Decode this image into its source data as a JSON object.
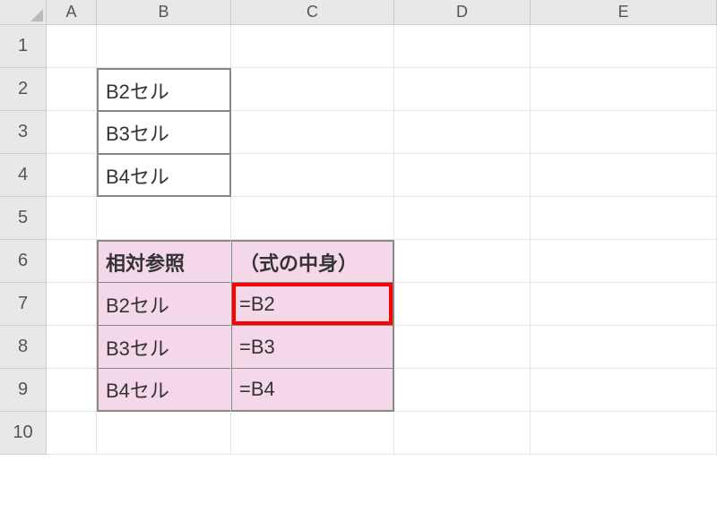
{
  "columns": [
    "A",
    "B",
    "C",
    "D",
    "E"
  ],
  "rows": [
    "1",
    "2",
    "3",
    "4",
    "5",
    "6",
    "7",
    "8",
    "9",
    "10"
  ],
  "cells": {
    "B2": "B2セル",
    "B3": "B3セル",
    "B4": "B4セル",
    "B6": "相対参照",
    "C6": "（式の中身）",
    "B7": "B2セル",
    "C7": "=B2",
    "B8": "B3セル",
    "C8": "=B3",
    "B9": "B4セル",
    "C9": "=B4"
  },
  "highlight_cell": "C7"
}
